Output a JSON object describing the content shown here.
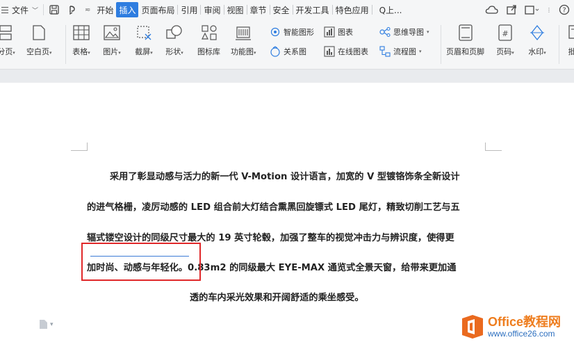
{
  "menubar": {
    "file_label": "文件",
    "tabs": [
      "开始",
      "插入",
      "页面布局",
      "引用",
      "审阅",
      "视图",
      "章节",
      "安全",
      "开发工具",
      "特色应用"
    ],
    "active_tab": "插入",
    "search_label": "Q上..."
  },
  "ribbon": {
    "page_break": "分页",
    "blank_page": "空白页",
    "table": "表格",
    "picture": "图片",
    "screenshot": "截屏",
    "shapes": "形状",
    "icon_library": "图标库",
    "function_chart": "功能图",
    "smart_graphic": "智能图形",
    "relation_chart": "关系图",
    "chart": "图表",
    "online_chart": "在线图表",
    "mind_map": "思维导图",
    "flowchart": "流程图",
    "header_footer": "页眉和页脚",
    "page_number": "页码",
    "watermark": "水印",
    "more": "批"
  },
  "document": {
    "lines": [
      "采用了彰显动感与活力的新一代 V-Motion 设计语言，加宽的 V 型镀铬饰条全新设计",
      "的进气格栅，凌厉动感的 LED 组合前大灯结合熏黑回旋镖式 LED 尾灯，精致切削工艺与五",
      "辐式镂空设计的同级尺寸最大的 19 英寸轮毂，加强了整车的视觉冲击力与辨识度，使得更",
      "加时尚、动感与年轻化。0.83m2 的同级最大 EYE-MAX 通览式全景天窗，给带来更加通",
      "透的车内采光效果和开阔舒适的乘坐感受。"
    ]
  },
  "watermark_logo": {
    "title": "Office教程网",
    "url": "www.office26.com"
  },
  "colors": {
    "accent": "#2e7de0",
    "highlight_box": "#e0282a",
    "logo_orange": "#ee7d1e",
    "logo_blue": "#2c6fbf"
  }
}
